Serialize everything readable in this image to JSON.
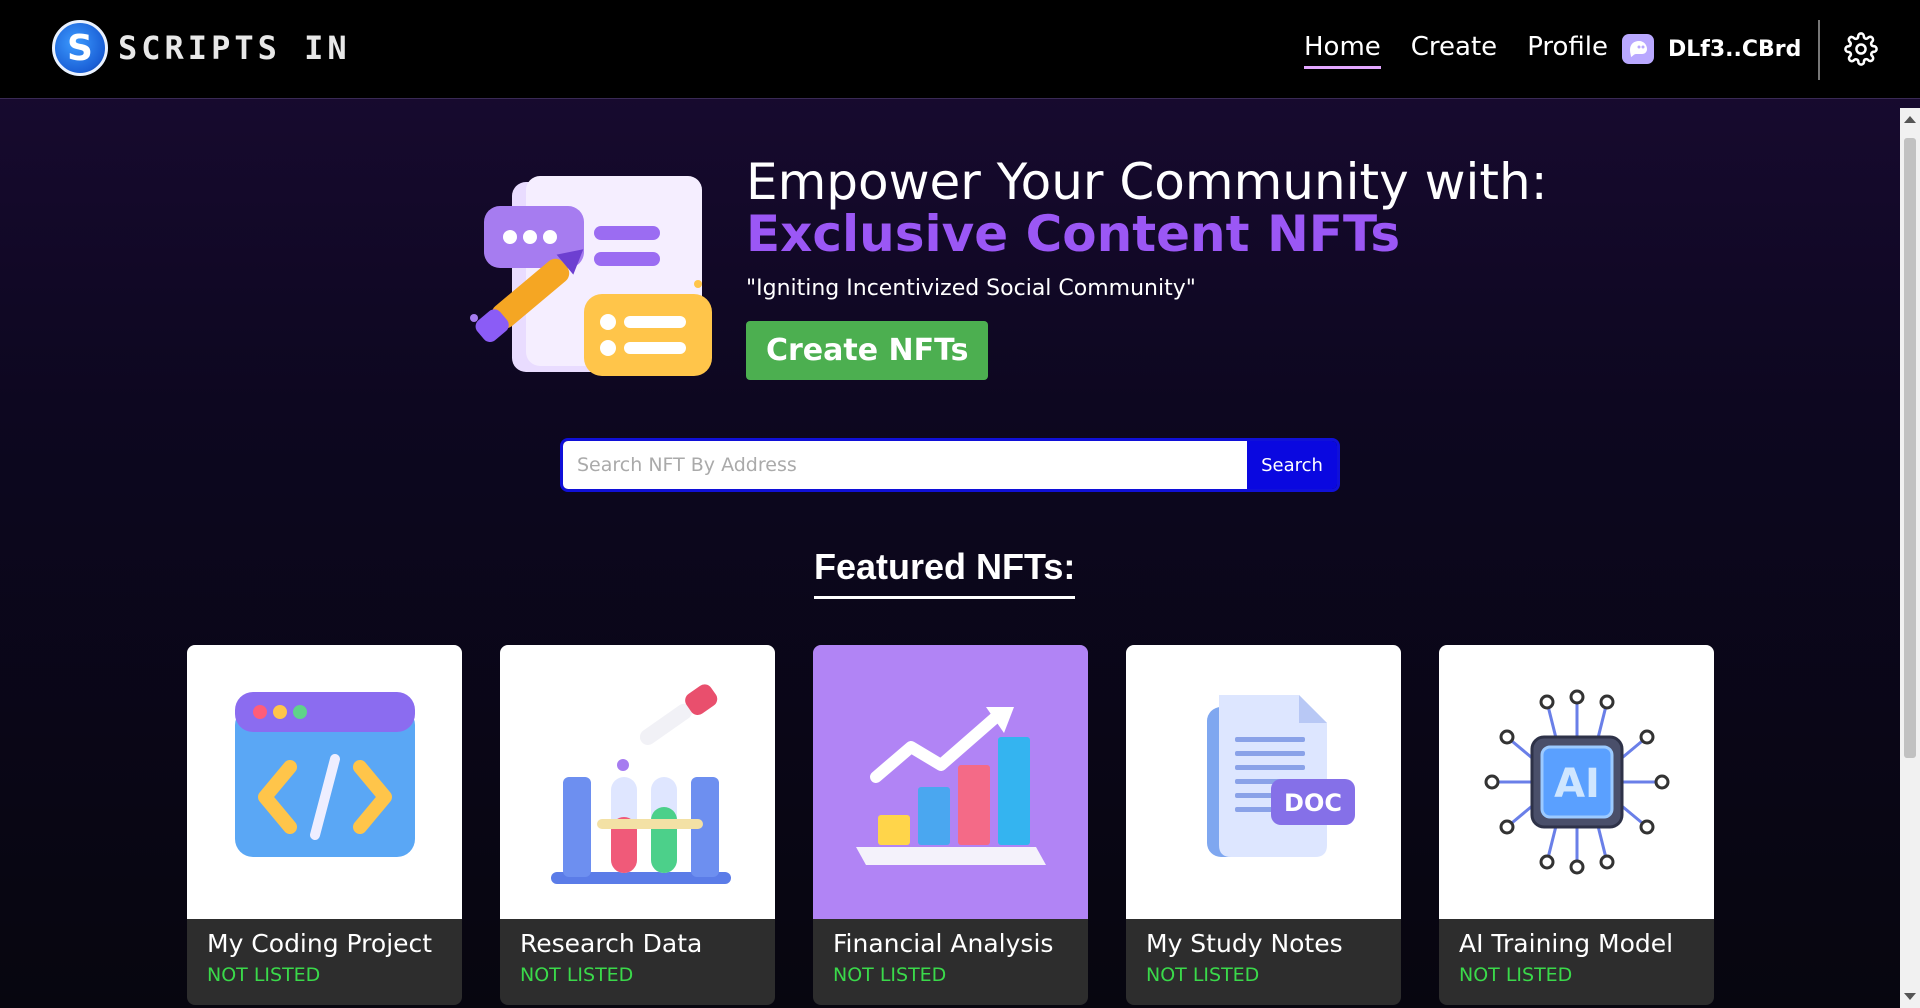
{
  "brand": {
    "logo_letter": "S",
    "name": "SCRIPTS IN"
  },
  "nav": {
    "links": [
      {
        "label": "Home",
        "active": true
      },
      {
        "label": "Create",
        "active": false
      },
      {
        "label": "Profile",
        "active": false
      }
    ],
    "wallet_label": "DLf3..CBrd"
  },
  "hero": {
    "title": "Empower Your Community with:",
    "highlight": "Exclusive Content NFTs",
    "tagline": "\"Igniting Incentivized Social Community\"",
    "button_label": "Create NFTs"
  },
  "search": {
    "placeholder": "Search NFT By Address",
    "button_label": "Search"
  },
  "featured": {
    "title": "Featured NFTs:",
    "cards": [
      {
        "name": "My Coding Project",
        "status": "NOT LISTED",
        "icon": "code-window-icon"
      },
      {
        "name": "Research Data",
        "status": "NOT LISTED",
        "icon": "test-tubes-icon"
      },
      {
        "name": "Financial Analysis",
        "status": "NOT LISTED",
        "icon": "bar-chart-icon"
      },
      {
        "name": "My Study Notes",
        "status": "NOT LISTED",
        "icon": "document-icon"
      },
      {
        "name": "AI Training Model",
        "status": "NOT LISTED",
        "icon": "ai-chip-icon"
      }
    ]
  },
  "colors": {
    "accent_purple": "#9b57f5",
    "create_button": "#4caf50",
    "search_button": "#0a08e0",
    "status_green": "#3ad94a",
    "active_underline": "#e2a7ff"
  }
}
